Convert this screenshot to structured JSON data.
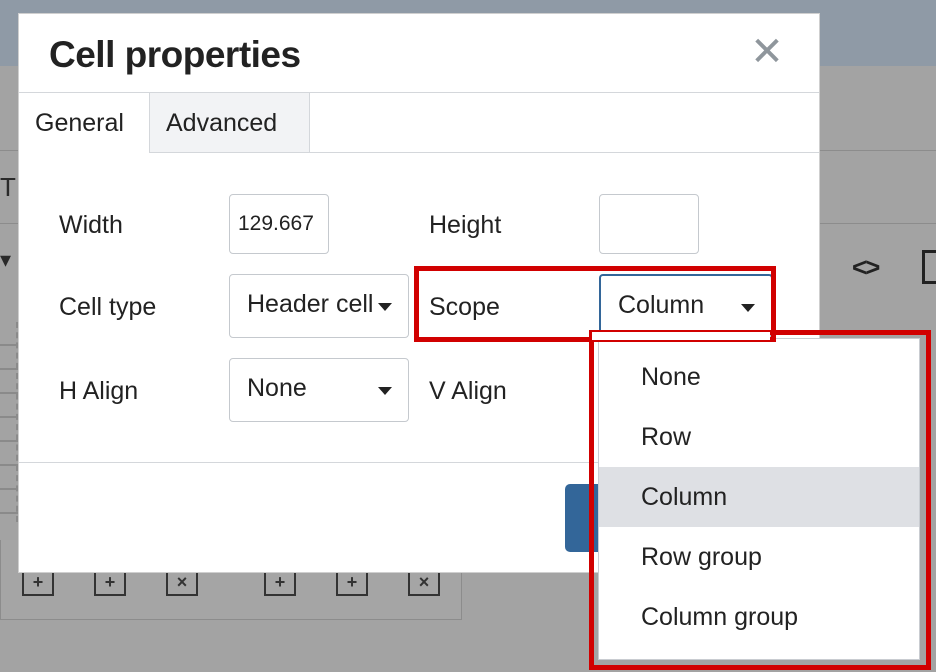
{
  "dialog": {
    "title": "Cell properties",
    "close_glyph": "✕",
    "tabs": [
      {
        "label": "General",
        "active": true
      },
      {
        "label": "Advanced",
        "active": false
      }
    ]
  },
  "form": {
    "width_label": "Width",
    "width_value": "129.667",
    "height_label": "Height",
    "height_value": "",
    "cell_type_label": "Cell type",
    "cell_type_value": "Header cell",
    "scope_label": "Scope",
    "scope_value": "Column",
    "h_align_label": "H Align",
    "h_align_value": "None",
    "v_align_label": "V Align"
  },
  "scope_options": [
    {
      "label": "None",
      "selected": false
    },
    {
      "label": "Row",
      "selected": false
    },
    {
      "label": "Column",
      "selected": true
    },
    {
      "label": "Row group",
      "selected": false
    },
    {
      "label": "Column group",
      "selected": false
    }
  ],
  "background": {
    "menu_fragment": "T",
    "toolbar_icons": [
      "table-insert-row-before-icon",
      "table-insert-row-after-icon",
      "table-delete-row-icon",
      "table-insert-col-before-icon",
      "table-insert-col-after-icon",
      "table-delete-col-icon"
    ],
    "code_icon_glyph": "<>"
  },
  "colors": {
    "highlight": "#d10000",
    "primary_button": "#336699",
    "selected_option": "#dee0e4"
  }
}
